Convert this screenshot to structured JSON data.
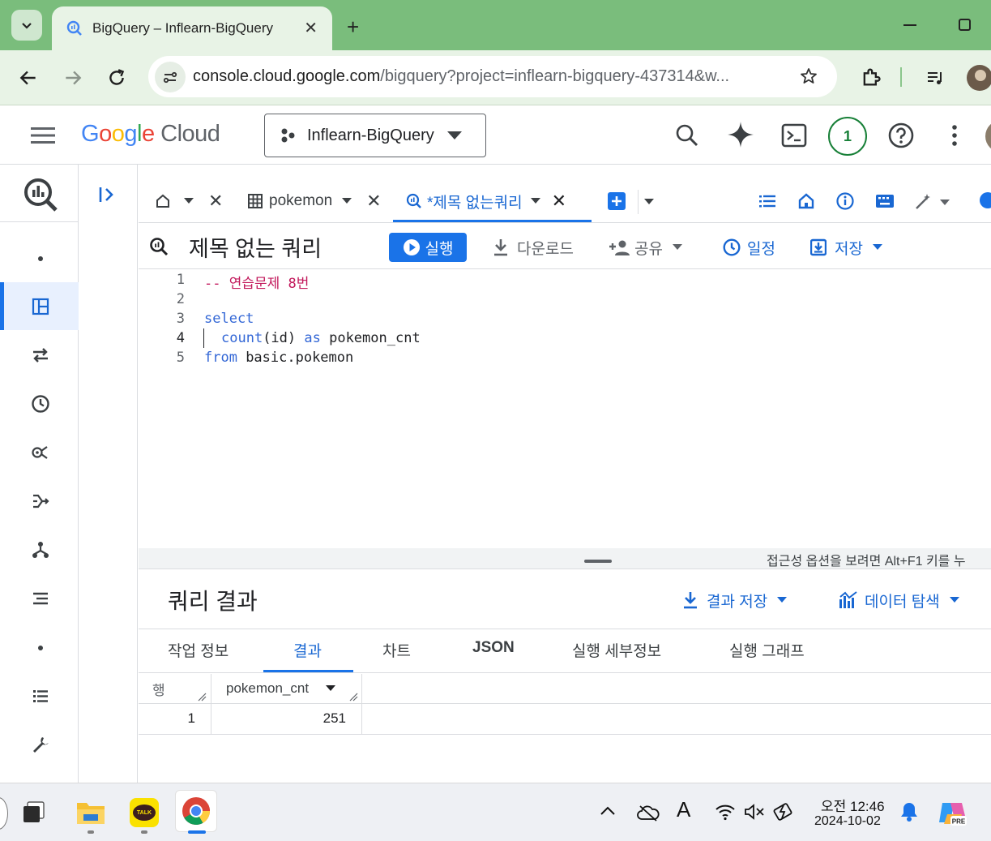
{
  "browser": {
    "tab_title": "BigQuery – Inflearn-BigQuery",
    "tab_close": "✕",
    "new_tab": "+",
    "url_host": "console.cloud.google.com",
    "url_rest": "/bigquery?project=inflearn-bigquery-437314&w..."
  },
  "header": {
    "logo_google": "Google",
    "logo_cloud": "Cloud",
    "project_name": "Inflearn-BigQuery",
    "notification_count": "1"
  },
  "editor_tabs": {
    "tab1_label": "pokemon",
    "tab2_label": "*제목 없는쿼리",
    "close": "✕"
  },
  "query": {
    "title": "제목 없는 쿼리",
    "run": "실행",
    "download": "다운로드",
    "share": "공유",
    "schedule": "일정",
    "save": "저장"
  },
  "code": {
    "line_numbers": [
      "1",
      "2",
      "3",
      "4",
      "5"
    ],
    "line1": "-- 연습문제 8번",
    "line3": "select",
    "line4_fn": "count",
    "line4_args": "(id) ",
    "line4_as": "as",
    "line4_alias": " pokemon_cnt",
    "line5_kw": "from",
    "line5_rest": " basic.pokemon",
    "a11y_hint": "접근성 옵션을 보려면 Alt+F1 키를 누"
  },
  "results": {
    "title": "쿼리 결과",
    "save_results": "결과 저장",
    "explore_data": "데이터 탐색",
    "tabs": [
      "작업 정보",
      "결과",
      "차트",
      "JSON",
      "실행 세부정보",
      "실행 그래프"
    ],
    "col_row": "행",
    "col_name": "pokemon_cnt",
    "rows": [
      {
        "row": "1",
        "value": "251"
      }
    ]
  },
  "taskbar": {
    "time": "오전 12:46",
    "date": "2024-10-02",
    "ime": "A",
    "kakao": "TALK"
  },
  "colors": {
    "accent": "#1a73e8",
    "tabstrip": "#7abd7c",
    "toolbar": "#e8f3e6"
  }
}
